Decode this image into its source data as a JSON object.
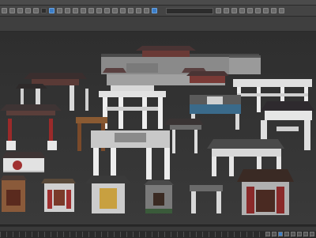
{
  "app": {
    "viewport_label": ""
  },
  "menubar": {
    "items": [
      "",
      "",
      "",
      "",
      "",
      "",
      "",
      "",
      "",
      "",
      "",
      "",
      ""
    ]
  },
  "toolbar": {
    "selection_set_placeholder": ""
  },
  "colors": {
    "viewport_bg": "#333333",
    "accent": "#3c7ec8"
  }
}
